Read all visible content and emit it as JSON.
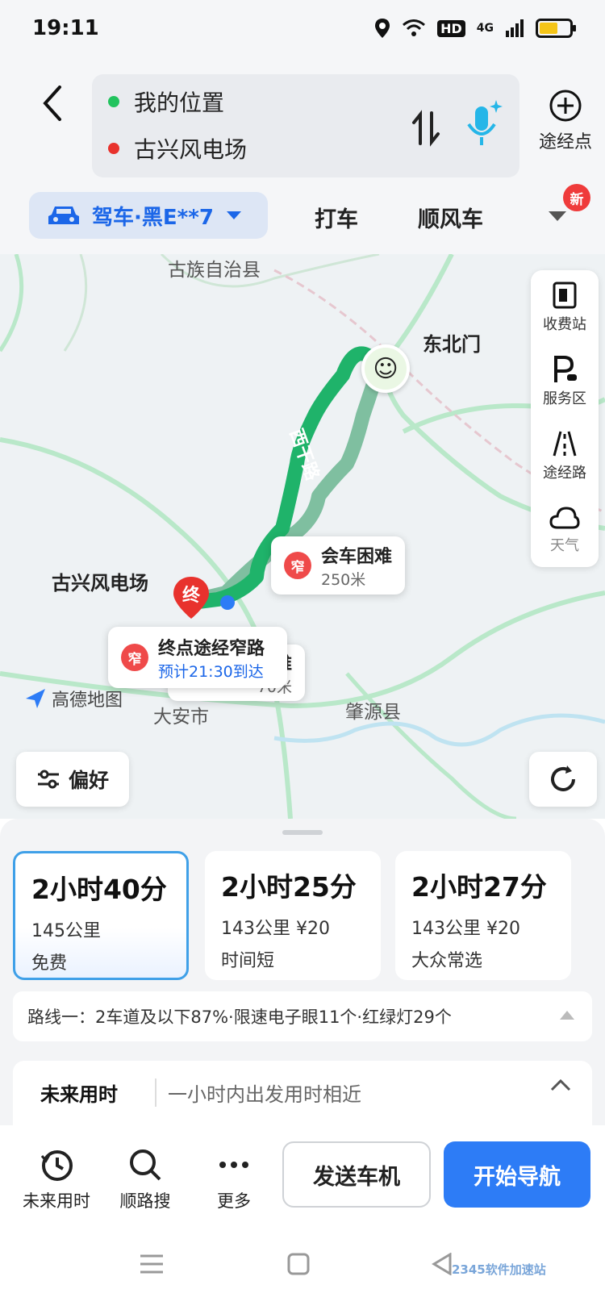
{
  "status_bar": {
    "time": "19:11",
    "network": "4G",
    "hd": "HD"
  },
  "header": {
    "origin": "我的位置",
    "destination": "古兴风电场",
    "waypoint_label": "途经点",
    "modes": {
      "drive": "驾车·黑E**7",
      "taxi": "打车",
      "ride_share": "顺风车",
      "new_badge": "新"
    }
  },
  "map": {
    "labels": {
      "county_top": "古族自治县",
      "gate": "东北门",
      "road": "西干路",
      "destination": "古兴风电场",
      "city_daan": "大安市",
      "county_zhaoyuan": "肇源县",
      "brand": "高德地图"
    },
    "end_pin": "终",
    "callouts": {
      "meeting": {
        "badge": "窄",
        "title": "会车困难",
        "sub": "250米"
      },
      "endpoint": {
        "badge": "窄",
        "title": "终点途经窄路",
        "sub": "预计21:30到达"
      },
      "hidden": {
        "title": "难",
        "sub": "70米"
      }
    },
    "tools": [
      {
        "label": "收费站",
        "icon": "toll-icon"
      },
      {
        "label": "服务区",
        "icon": "parking-icon"
      },
      {
        "label": "途经路",
        "icon": "road-icon"
      },
      {
        "label": "天气",
        "icon": "cloud-icon"
      }
    ],
    "preference": "偏好"
  },
  "routes": [
    {
      "time": "2小时40分",
      "distance": "145公里",
      "tag": "免费",
      "selected": true
    },
    {
      "time": "2小时25分",
      "distance": "143公里 ¥20",
      "tag": "时间短",
      "selected": false
    },
    {
      "time": "2小时27分",
      "distance": "143公里 ¥20",
      "tag": "大众常选",
      "selected": false
    }
  ],
  "route_info": "路线一：2车道及以下87%·限速电子眼11个·红绿灯29个",
  "future": {
    "title": "未来用时",
    "subtitle": "一小时内出发用时相近"
  },
  "actions": {
    "future_time": "未来用时",
    "search_along": "顺路搜",
    "more": "更多",
    "send_to_car": "发送车机",
    "start_nav": "开始导航"
  },
  "watermark": "2345软件加速站",
  "colors": {
    "route_green": "#1fb36a",
    "route_alt": "#7fbfa0",
    "accent_blue": "#2d7cf6",
    "end_red": "#e8322d"
  }
}
